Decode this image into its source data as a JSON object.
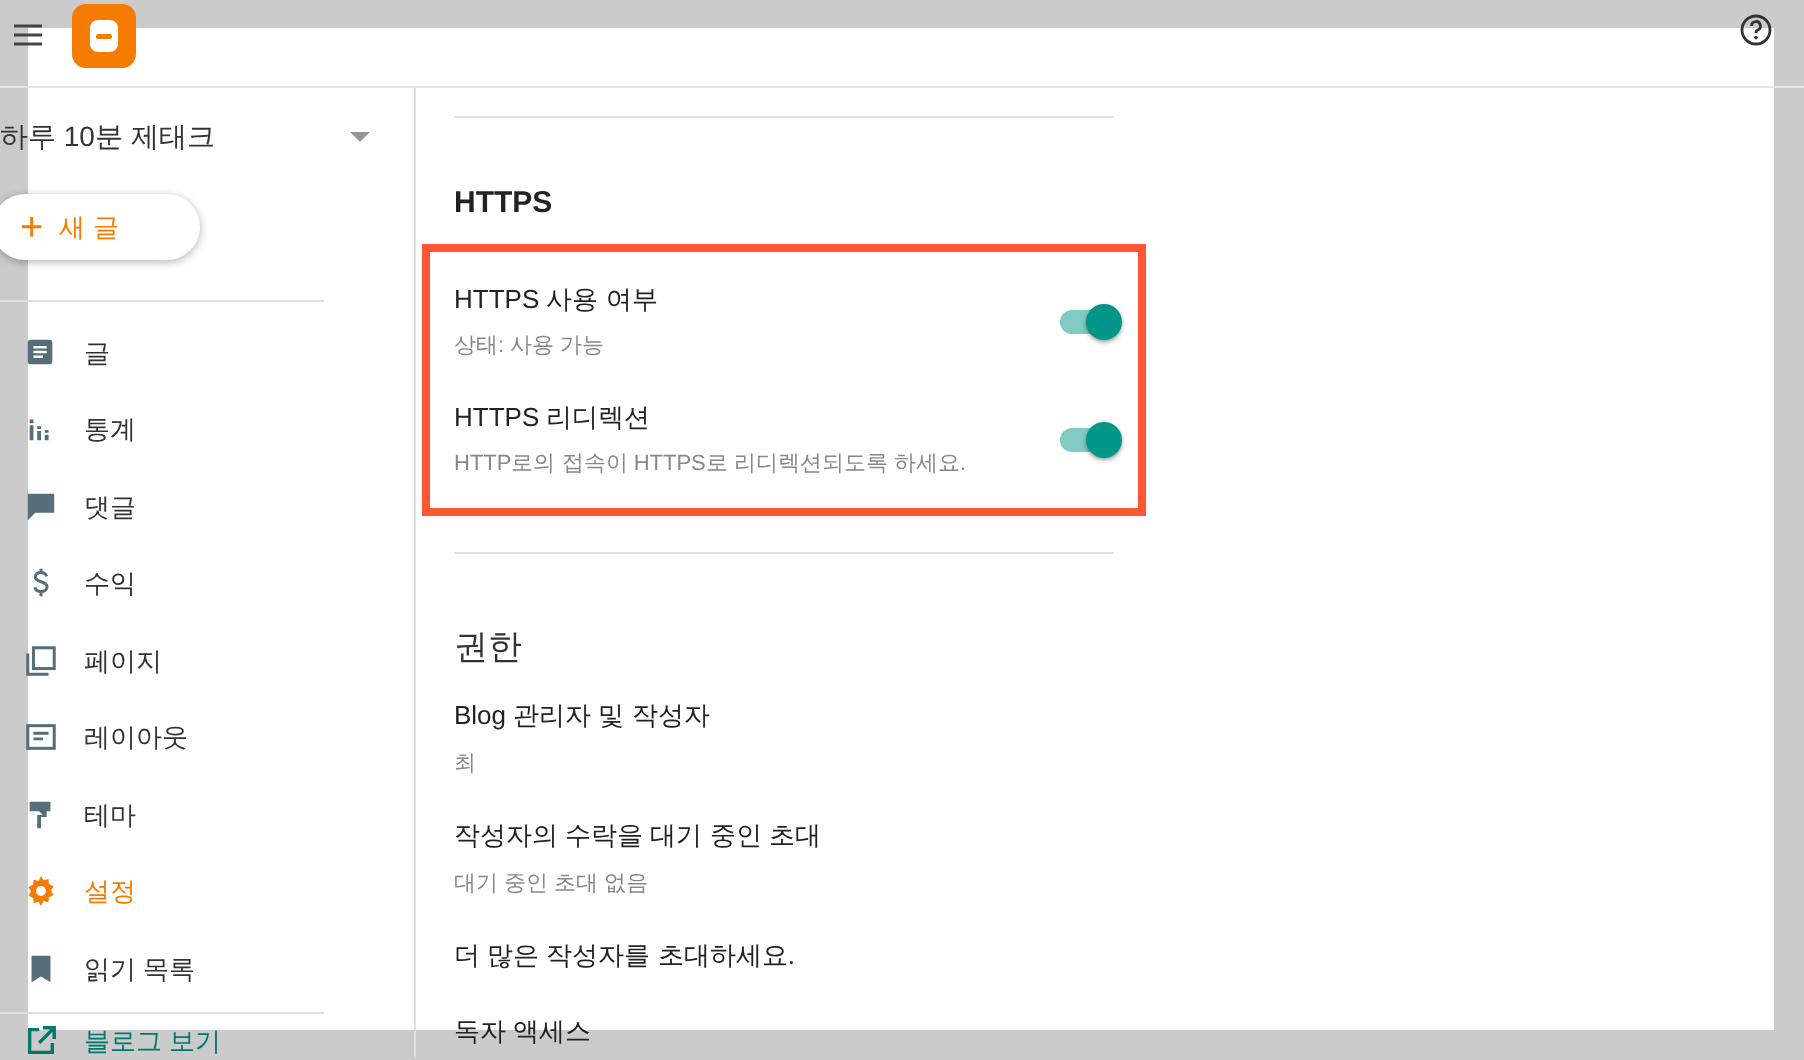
{
  "sidebar": {
    "blog_name": "하루 10분 제태크",
    "new_post_button": {
      "icon": "+",
      "label": "새 글"
    },
    "items": [
      {
        "label": "글",
        "selected": false
      },
      {
        "label": "통계",
        "selected": false
      },
      {
        "label": "댓글",
        "selected": false
      },
      {
        "label": "수익",
        "selected": false
      },
      {
        "label": "페이지",
        "selected": false
      },
      {
        "label": "레이아웃",
        "selected": false
      },
      {
        "label": "테마",
        "selected": false
      },
      {
        "label": "설정",
        "selected": true
      },
      {
        "label": "읽기 목록",
        "selected": false
      }
    ],
    "view_blog_link": "블로그 보기"
  },
  "sections": [
    {
      "kind": "toggles",
      "title": "HTTPS",
      "highlighted": true,
      "rows": [
        {
          "title": "HTTPS 사용 여부",
          "subtitle": "상태: 사용 가능",
          "on": true
        },
        {
          "title": "HTTPS 리디렉션",
          "subtitle": "HTTP로의 접속이 HTTPS로 리디렉션되도록 하세요.",
          "on": true
        }
      ]
    },
    {
      "kind": "list",
      "title": "권한",
      "rows": [
        {
          "title": "Blog 관리자 및 작성자",
          "subtitle": "최"
        },
        {
          "title": "작성자의 수락을 대기 중인 초대",
          "subtitle": "대기 중인 초대 없음"
        },
        {
          "title": "더 많은 작성자를 초대하세요."
        },
        {
          "title": "독자 액세스"
        }
      ]
    }
  ]
}
